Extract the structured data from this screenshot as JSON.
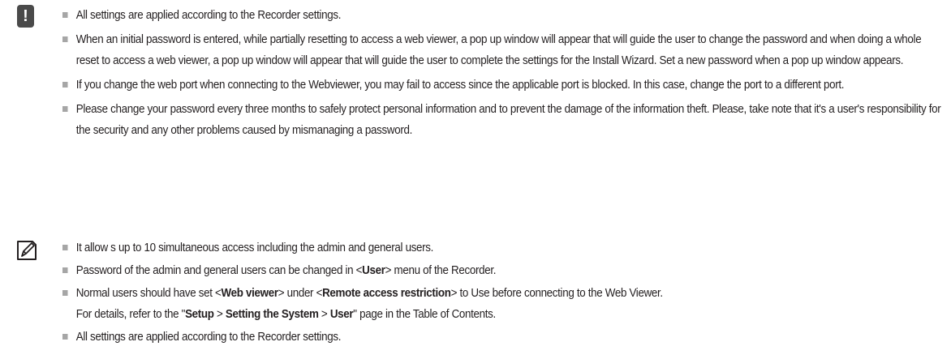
{
  "warning": {
    "icon": "exclamation-icon",
    "items": [
      "All settings are applied according to the Recorder settings.",
      "When an initial password is entered, while partially resetting to access a web viewer, a pop up window will appear that will guide the user to change the password and when doing a whole reset to access a web viewer, a pop up window will appear that will guide the user to complete the settings for the Install Wizard. Set a new password when a pop up window appears.",
      "If you change the web port when connecting to the Webviewer, you may fail to access since the applicable port is blocked. In this case, change the port to a different port.",
      "Please change your password every three months to safely protect personal information and to prevent the damage of the information theft. Please, take note that it's a user's responsibility for the security and any other problems caused by mismanaging a password."
    ]
  },
  "note": {
    "icon": "note-pencil-icon",
    "item1": "It allow s up to 10 simultaneous access including the admin and general users.",
    "item2": {
      "pre": "Password of the admin and general users can be changed in <",
      "bold": "User",
      "post": "> menu of the Recorder."
    },
    "item3": {
      "a": "Normal users should have set <",
      "b1": "Web viewer",
      "c": "> under <",
      "b2": "Remote access restriction",
      "d": "> to Use before connecting to the Web Viewer.",
      "e": "For details, refer to the \"",
      "b3": "Setup",
      "f": " > ",
      "b4": "Setting the System",
      "g": " > ",
      "b5": "User",
      "h": "\" page in the Table of Contents."
    },
    "item4": "All settings are applied according to the Recorder settings."
  }
}
